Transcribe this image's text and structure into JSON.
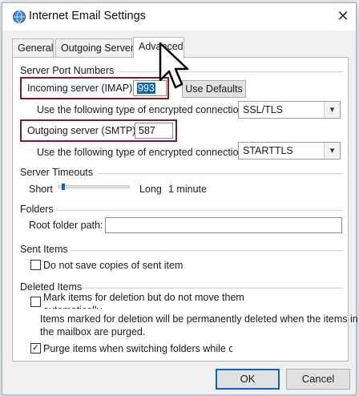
{
  "window": {
    "title": "Internet Email Settings",
    "close_glyph": "✕"
  },
  "tabs": [
    {
      "label": "General",
      "active": false
    },
    {
      "label": "Outgoing Server",
      "active": false
    },
    {
      "label": "Advanced",
      "active": true
    }
  ],
  "server_ports": {
    "group_label": "Server Port Numbers",
    "incoming_label": "Incoming server (IMAP):",
    "incoming_value": "993",
    "use_defaults_label": "Use Defaults",
    "encryption_label": "Use the following type of encrypted connection:",
    "incoming_encryption": "SSL/TLS",
    "outgoing_label": "Outgoing server (SMTP):",
    "outgoing_value": "587",
    "outgoing_encryption": "STARTTLS"
  },
  "timeouts": {
    "group_label": "Server Timeouts",
    "short_label": "Short",
    "long_label": "Long",
    "value_label": "1 minute",
    "slider_level": 0.05
  },
  "folders": {
    "group_label": "Folders",
    "root_label": "Root folder path:",
    "root_value": ""
  },
  "sent_items": {
    "group_label": "Sent Items",
    "do_not_save_label": "Do not save copies of sent item",
    "do_not_save_checked": false
  },
  "deleted_items": {
    "group_label": "Deleted Items",
    "mark_label_line1": "Mark items for deletion but do not move them",
    "mark_label_line2": "automatically",
    "mark_checked": false,
    "note_line1": "Items marked for deletion will be permanently deleted when the items in",
    "note_line2": "the mailbox are purged.",
    "purge_label": "Purge items when switching folders while onlin",
    "purge_checked": true,
    "check_glyph": "✓"
  },
  "footer": {
    "ok_label": "OK",
    "cancel_label": "Cancel"
  },
  "colors": {
    "highlight_box": "#8a1622",
    "selection": "#0a64c8"
  },
  "icons": {
    "title": "globe-envelope-icon",
    "combo": "chevron-down-icon",
    "cursor": "mouse-pointer-icon"
  }
}
